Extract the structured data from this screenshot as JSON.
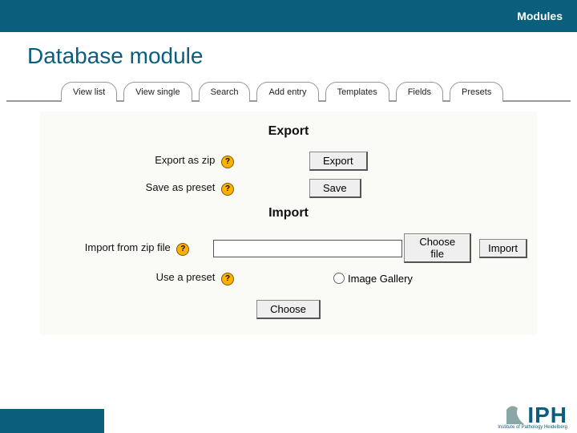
{
  "header": {
    "section_label": "Modules"
  },
  "page_title": "Database module",
  "tabs": [
    {
      "label": "View list"
    },
    {
      "label": "View single"
    },
    {
      "label": "Search"
    },
    {
      "label": "Add entry"
    },
    {
      "label": "Templates"
    },
    {
      "label": "Fields"
    },
    {
      "label": "Presets"
    }
  ],
  "export": {
    "heading": "Export",
    "zip_label": "Export as zip",
    "zip_button": "Export",
    "preset_label": "Save as preset",
    "preset_button": "Save",
    "help": "?"
  },
  "import": {
    "heading": "Import",
    "zip_label": "Import from zip file",
    "choose_file": "Choose file",
    "import_button": "Import",
    "preset_label": "Use a preset",
    "preset_option": "Image Gallery",
    "choose_button": "Choose",
    "help": "?"
  },
  "footer": {
    "logo_text": "IPH",
    "logo_sub": "Institute of Pathology Heidelberg"
  }
}
